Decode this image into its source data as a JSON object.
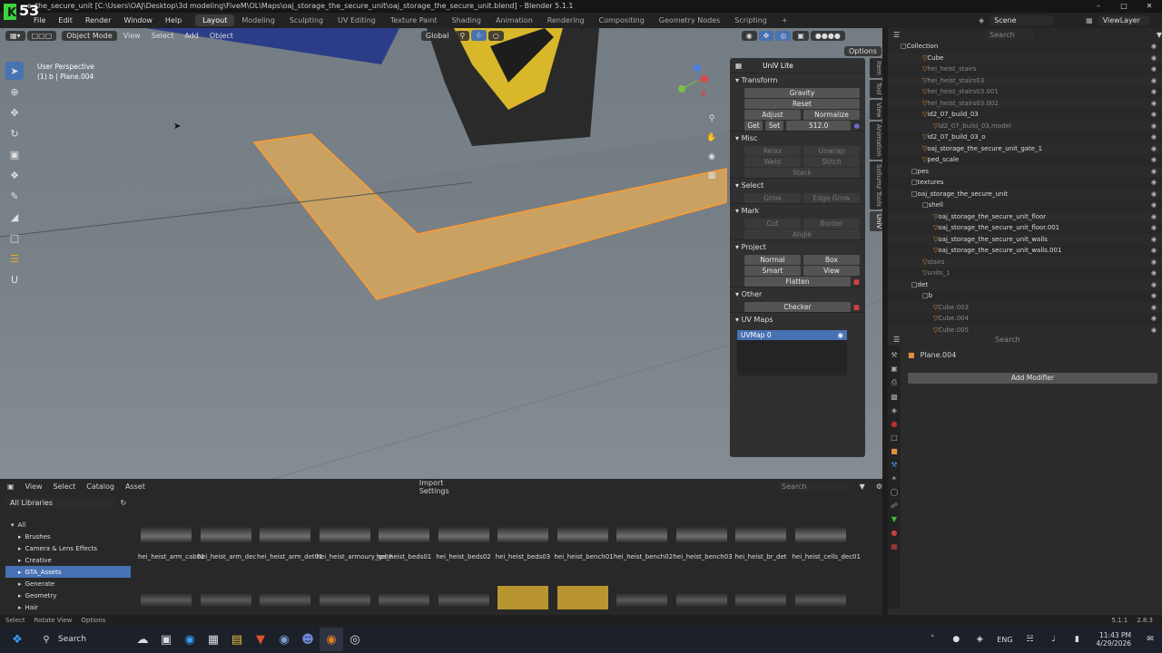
{
  "app": {
    "title": "e_the_secure_unit [C:\\Users\\OAJ\\Desktop\\3d modeling\\FiveM\\OL\\Maps\\oaj_storage_the_secure_unit\\oaj_storage_the_secure_unit.blend] - Blender 5.1.1",
    "logo_text": "53",
    "scene": "Scene",
    "view_layer": "ViewLayer"
  },
  "menu": [
    "File",
    "Edit",
    "Render",
    "Window",
    "Help"
  ],
  "workspaces": [
    "Layout",
    "Modeling",
    "Sculpting",
    "UV Editing",
    "Texture Paint",
    "Shading",
    "Animation",
    "Rendering",
    "Compositing",
    "Geometry Nodes",
    "Scripting"
  ],
  "active_workspace": "Layout",
  "viewport": {
    "mode": "Object Mode",
    "menus": [
      "View",
      "Select",
      "Add",
      "Object"
    ],
    "orientation": "Global",
    "options": "Options",
    "persp_label": "User Perspective",
    "object_label": "(1) b | Plane.004"
  },
  "npanel": {
    "title": "UniV Lite",
    "sections": {
      "transform": "Transform",
      "misc": "Misc",
      "select": "Select",
      "mark": "Mark",
      "project": "Project",
      "other": "Other",
      "uvmaps": "UV Maps"
    },
    "gravity": "Gravity",
    "reset": "Reset",
    "adjust": "Adjust",
    "normalize": "Normalize",
    "get": "Get",
    "set": "Set",
    "size": "512.0",
    "relax": "Relax",
    "unwrap": "Unwrap",
    "weld": "Weld",
    "stitch": "Stitch",
    "stack": "Stack",
    "grow": "Grow",
    "edge_grow": "Edge Grow",
    "cut": "Cut",
    "border": "Border",
    "angle": "Angle",
    "normal": "Normal",
    "box": "Box",
    "smart": "Smart",
    "view": "View",
    "flatten": "Flatten",
    "checker": "Checker",
    "uvmap": "UVMap 0",
    "tabs": [
      "Item",
      "Tool",
      "View",
      "Animation",
      "Sollumz Tools",
      "UniV"
    ]
  },
  "outliner": {
    "search": "Search",
    "rows": [
      {
        "t": "Collection",
        "d": 0,
        "c": "#ddd"
      },
      {
        "t": "Cube",
        "d": 2,
        "c": "#ddd"
      },
      {
        "t": "hei_heist_stairs",
        "d": 2,
        "c": "#888"
      },
      {
        "t": "hei_heist_stairs03",
        "d": 2,
        "c": "#888"
      },
      {
        "t": "hei_heist_stairs03.001",
        "d": 2,
        "c": "#888"
      },
      {
        "t": "hei_heist_stairs03.002",
        "d": 2,
        "c": "#888"
      },
      {
        "t": "id2_07_build_03",
        "d": 2,
        "c": "#ddd"
      },
      {
        "t": "id2_07_build_03.model",
        "d": 3,
        "c": "#888"
      },
      {
        "t": "id2_07_build_03_o",
        "d": 2,
        "c": "#ddd"
      },
      {
        "t": "oaj_storage_the_secure_unit_gate_1",
        "d": 2,
        "c": "#ddd"
      },
      {
        "t": "ped_scale",
        "d": 2,
        "c": "#ddd"
      },
      {
        "t": "pes",
        "d": 1,
        "c": "#ddd"
      },
      {
        "t": "textures",
        "d": 1,
        "c": "#ddd"
      },
      {
        "t": "oaj_storage_the_secure_unit",
        "d": 1,
        "c": "#ddd"
      },
      {
        "t": "shell",
        "d": 2,
        "c": "#ddd"
      },
      {
        "t": "oaj_storage_the_secure_unit_floor",
        "d": 3,
        "c": "#ddd"
      },
      {
        "t": "oaj_storage_the_secure_unit_floor.001",
        "d": 3,
        "c": "#ddd"
      },
      {
        "t": "oaj_storage_the_secure_unit_walls",
        "d": 3,
        "c": "#ddd"
      },
      {
        "t": "oaj_storage_the_secure_unit_walls.001",
        "d": 3,
        "c": "#ddd"
      },
      {
        "t": "stairs",
        "d": 2,
        "c": "#888"
      },
      {
        "t": "units_1",
        "d": 2,
        "c": "#888"
      },
      {
        "t": "det",
        "d": 1,
        "c": "#ddd"
      },
      {
        "t": "b",
        "d": 2,
        "c": "#ddd"
      },
      {
        "t": "Cube.003",
        "d": 3,
        "c": "#888"
      },
      {
        "t": "Cube.004",
        "d": 3,
        "c": "#888"
      },
      {
        "t": "Cube.005",
        "d": 3,
        "c": "#888"
      }
    ]
  },
  "properties": {
    "search": "Search",
    "object": "Plane.004",
    "add_modifier": "Add Modifier"
  },
  "asset_browser": {
    "menus": [
      "View",
      "Select",
      "Catalog",
      "Asset"
    ],
    "import": "Import Settings",
    "search": "Search",
    "library": "All Libraries",
    "catalogs": [
      "All",
      "Brushes",
      "Camera & Lens Effects",
      "Creative",
      "GTA_Assets",
      "Generate",
      "Geometry",
      "Hair"
    ],
    "active_catalog": "GTA_Assets",
    "assets": [
      "hei_heist_arm_cab01",
      "hei_heist_arm_dec",
      "hei_heist_arm_det01",
      "hei_heist_armoury_gate",
      "hei_heist_beds01",
      "hei_heist_beds02",
      "hei_heist_beds03",
      "hei_heist_bench01",
      "hei_heist_bench02",
      "hei_heist_bench03",
      "hei_heist_br_det",
      "hei_heist_cells_dec01"
    ]
  },
  "status": {
    "select": "Select",
    "rotate": "Rotate View",
    "options": "Options",
    "version": "5.1.1",
    "fps": "2.8.3"
  },
  "taskbar": {
    "search": "Search",
    "lang": "ENG",
    "time": "11:43 PM",
    "date": "4/29/2026"
  }
}
